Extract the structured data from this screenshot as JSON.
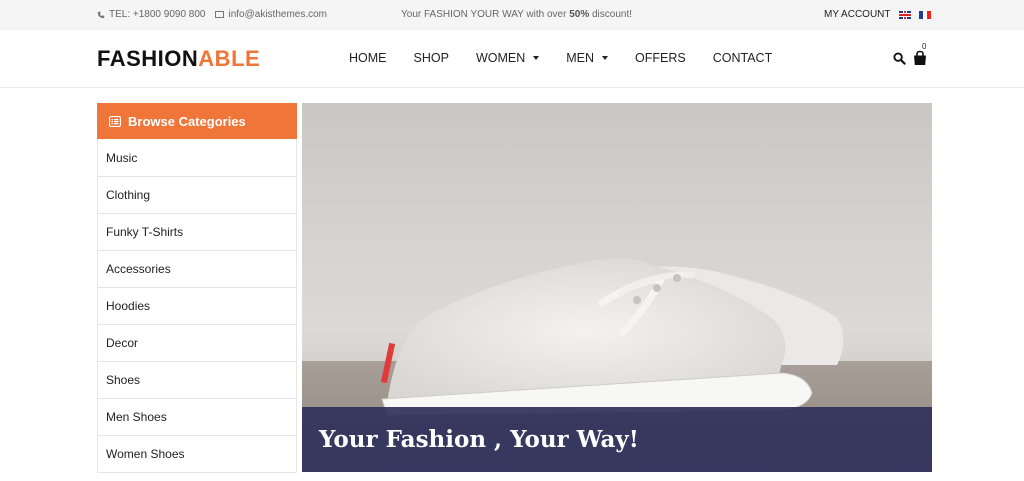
{
  "topbar": {
    "phone": "TEL: +1800 9090 800",
    "email": "info@akisthemes.com",
    "promo_prefix": "Your FASHION YOUR WAY with over ",
    "promo_highlight": "50%",
    "promo_suffix": " discount!",
    "account_label": "MY ACCOUNT",
    "languages": [
      {
        "icon": "uk-flag-icon"
      },
      {
        "icon": "france-flag-icon"
      }
    ]
  },
  "header": {
    "logo_main": "FASHION",
    "logo_accent": "ABLE",
    "nav": [
      {
        "label": "HOME",
        "dropdown": false
      },
      {
        "label": "SHOP",
        "dropdown": false
      },
      {
        "label": "WOMEN",
        "dropdown": true
      },
      {
        "label": "MEN",
        "dropdown": true
      },
      {
        "label": "OFFERS",
        "dropdown": false
      },
      {
        "label": "CONTACT",
        "dropdown": false
      }
    ],
    "cart_count": "0"
  },
  "sidebar": {
    "title": "Browse Categories",
    "items": [
      {
        "label": "Music"
      },
      {
        "label": "Clothing"
      },
      {
        "label": "Funky T-Shirts"
      },
      {
        "label": "Accessories"
      },
      {
        "label": "Hoodies"
      },
      {
        "label": "Decor"
      },
      {
        "label": "Shoes"
      },
      {
        "label": "Men Shoes"
      },
      {
        "label": "Women Shoes"
      }
    ]
  },
  "banner": {
    "caption": "Your Fashion , Your Way!"
  },
  "colors": {
    "accent": "#f07539",
    "caption_bg": "#30325c",
    "topbar_bg": "#f5f5f5"
  }
}
